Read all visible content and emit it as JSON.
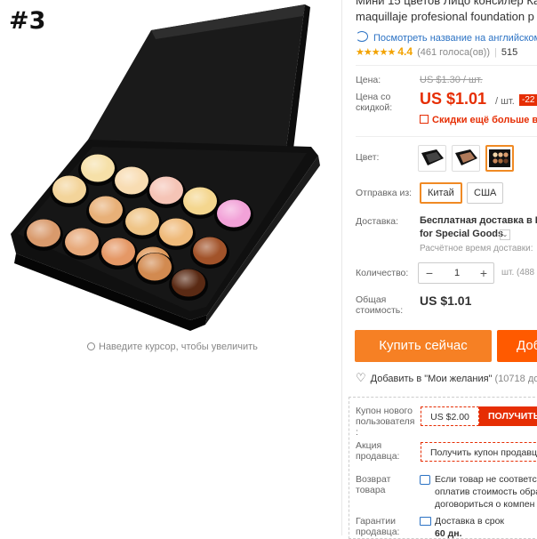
{
  "image": {
    "badge": "#3",
    "zoom_hint": "Наведите курсор, чтобы увеличить"
  },
  "product": {
    "title_line1": "Мини 15 цветов Лицо консилер Ка",
    "title_line2": "maquillaje profesional foundation p",
    "translate_link": "Посмотреть название на английском",
    "rating_stars": "★★★★★",
    "rating_score": "4.4",
    "rating_votes": "(461 голоса(ов))",
    "rating_sep": "|",
    "orders": "515"
  },
  "price": {
    "label": "Цена:",
    "old_value": "US $1.30 / шт.",
    "sale_label": "Цена со скидкой:",
    "new_value": "US $1.01",
    "unit": "/ шт.",
    "discount": "-22",
    "promo": "Скидки ещё больше в пр"
  },
  "options": {
    "color_label": "Цвет:",
    "selected_swatch_index": 3,
    "ship_from_label": "Отправка из:",
    "ship_from_options": [
      "Китай",
      "США"
    ],
    "ship_from_selected": "Китай"
  },
  "delivery": {
    "label": "Доставка:",
    "line1": "Бесплатная доставка в Ru",
    "line2": "for Special Goods",
    "chevron": "⌄",
    "line3": "Расчётное время доставки:"
  },
  "quantity": {
    "label": "Количество:",
    "minus": "−",
    "value": "1",
    "plus": "+",
    "available": "шт. (488"
  },
  "total": {
    "label": "Общая стоимость:",
    "value": "US $1.01"
  },
  "actions": {
    "buy_now": "Купить сейчас",
    "add_to_cart": "Доб",
    "wishlist": "Добавить в \"Мои желания\"",
    "wishlist_count": "(10718 до"
  },
  "coupons": {
    "new_user_label": "Купон нового пользователя :",
    "new_user_amount": "US $2.00",
    "new_user_get": "ПОЛУЧИТЬ",
    "seller_label": "Акция продавца:",
    "seller_btn": "Получить купон продавц",
    "return_label": "Возврат товара",
    "return_line1": "Если товар не соответст",
    "return_line2": "оплатив стоимость обра",
    "return_line3": "договориться о компен",
    "guarantee_label": "Гарантии продавца:",
    "guarantee_line1": "Доставка в срок",
    "guarantee_line2": "60 дн."
  },
  "colors": {
    "accent_orange": "#f68024",
    "cart_orange": "#ff5a00",
    "price_red": "#e62e04",
    "link_blue": "#2b72c4",
    "star_gold": "#f2a200"
  }
}
